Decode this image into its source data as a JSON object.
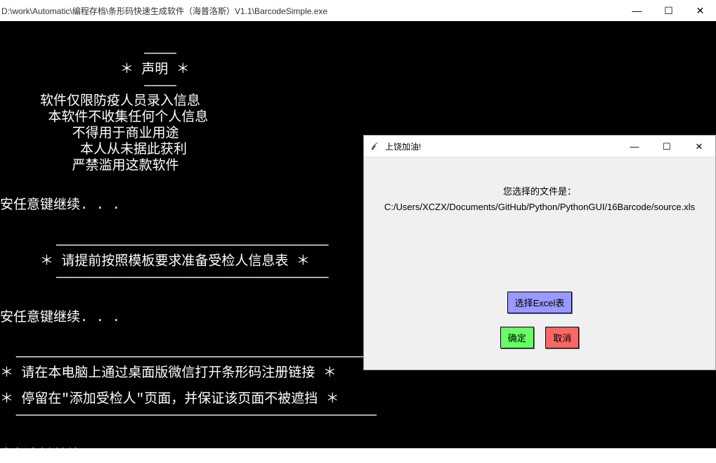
{
  "main": {
    "title": " D:\\work\\Automatic\\编程存档\\条形码快速生成软件（海普洛斯）V1.1\\BarcodeSimple.exe",
    "minimize": "—",
    "maximize": "☐",
    "close": "✕"
  },
  "console": {
    "l1": "                  ————",
    "l2": "               ＊ 声明 ＊",
    "l3": "                  ————",
    "l4": "     软件仅限防疫人员录入信息",
    "l5": "      本软件不收集任何个人信息",
    "l6": "         不得用于商业用途",
    "l7": "          本人从未据此获利",
    "l8": "         严禁滥用这款软件",
    "cont1": "安任意键继续. . .",
    "sep1": "       ——————————————————————————————————",
    "l9": "     ＊ 请提前按照模板要求准备受检人信息表 ＊",
    "sep2": "       ——————————————————————————————————",
    "cont2": "安任意键继续. . .",
    "sep3": "  —————————————————————————————————————————————",
    "l10": "＊ 请在本电脑上通过桌面版微信打开条形码注册链接 ＊",
    "l11": "＊ 停留在\"添加受检人\"页面，并保证该页面不被遮挡 ＊",
    "sep4": "  —————————————————————————————————————————————",
    "cont3": "安任意键继续. . ."
  },
  "dialog": {
    "title": "上饶加油!",
    "minimize": "—",
    "maximize": "☐",
    "close": "✕",
    "message_prefix": "您选择的文件是：",
    "file_path": "C:/Users/XCZX/Documents/GitHub/Python/PythonGUI/16Barcode/source.xls",
    "select_label": "选择Excel表",
    "ok_label": "确定",
    "cancel_label": "取消"
  }
}
